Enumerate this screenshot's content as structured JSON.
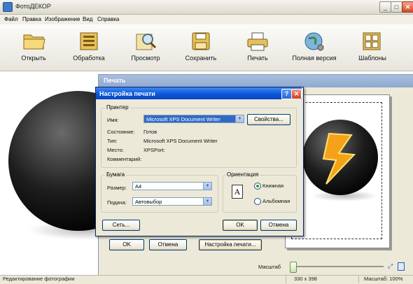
{
  "window": {
    "title": "ФотоДЕКОР",
    "minimize": "_",
    "maximize": "□",
    "close": "✕"
  },
  "menu": [
    "Файл",
    "Правка",
    "Изображение",
    "Вид",
    "Справка"
  ],
  "toolbar": [
    {
      "label": "Открыть",
      "icon": "folder-icon"
    },
    {
      "label": "Обработка",
      "icon": "edit-icon"
    },
    {
      "label": "Просмотр",
      "icon": "preview-icon"
    },
    {
      "label": "Сохранить",
      "icon": "save-icon"
    },
    {
      "label": "Печать",
      "icon": "printer-icon"
    },
    {
      "label": "Полная версия",
      "icon": "globe-icon"
    },
    {
      "label": "Шаблоны",
      "icon": "templates-icon"
    }
  ],
  "print_dialog": {
    "title": "Печать",
    "ok": "OK",
    "cancel": "Отмена",
    "setup": "Настройка печати..."
  },
  "setup_dialog": {
    "title": "Настройка печати",
    "help": "?",
    "close": "✕",
    "printer_group": "Принтер",
    "name_label": "Имя:",
    "name_value": "Microsoft XPS Document Writer",
    "properties": "Свойства...",
    "status_label": "Состояние:",
    "status_value": "Готов",
    "type_label": "Тип:",
    "type_value": "Microsoft XPS Document Writer",
    "where_label": "Место:",
    "where_value": "XPSPort:",
    "comment_label": "Комментарий:",
    "paper_group": "Бумага",
    "size_label": "Размер:",
    "size_value": "A4",
    "source_label": "Подача:",
    "source_value": "Автовыбор",
    "orientation_group": "Ориентация",
    "portrait": "Книжная",
    "landscape": "Альбомная",
    "orientation_selected": "portrait",
    "network": "Сеть...",
    "ok": "OK",
    "cancel": "Отмена"
  },
  "zoom": {
    "label": "Масштаб"
  },
  "status": {
    "left": "Редактирование фотографии",
    "size": "330 x 398",
    "zoom": "Масштаб: 100%"
  },
  "colors": {
    "title_active": "#0a55d8",
    "title_inactive": "#8fa9cf",
    "dialog_bg": "#ece9d8"
  }
}
